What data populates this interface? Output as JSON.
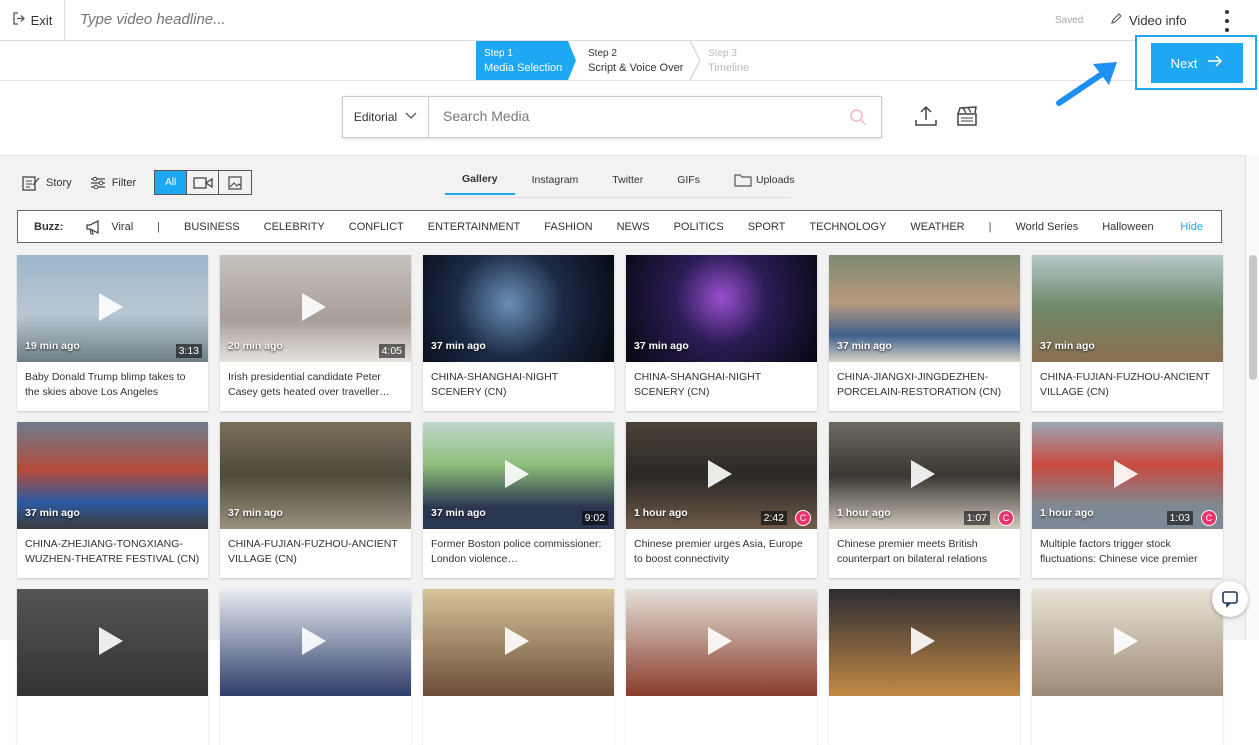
{
  "topbar": {
    "exit_label": "Exit",
    "headline_placeholder": "Type video headline...",
    "saved_label": "Saved",
    "video_info_label": "Video info"
  },
  "steps": [
    {
      "number": "Step 1",
      "label": "Media Selection",
      "state": "active"
    },
    {
      "number": "Step 2",
      "label": "Script & Voice Over",
      "state": "enabled"
    },
    {
      "number": "Step 3",
      "label": "Timeline",
      "state": "disabled"
    }
  ],
  "next_button_label": "Next",
  "accent_color": "#1ea7f3",
  "search": {
    "source_selected": "Editorial",
    "placeholder": "Search Media"
  },
  "toolbar": {
    "story_label": "Story",
    "filter_label": "Filter",
    "type_all_label": "All"
  },
  "source_tabs": [
    "Gallery",
    "Instagram",
    "Twitter",
    "GIFs",
    "Uploads"
  ],
  "buzz": {
    "label": "Buzz:",
    "viral_label": "Viral",
    "categories": [
      "BUSINESS",
      "CELEBRITY",
      "CONFLICT",
      "ENTERTAINMENT",
      "FASHION",
      "NEWS",
      "POLITICS",
      "SPORT",
      "TECHNOLOGY",
      "WEATHER"
    ],
    "trending": [
      "World Series",
      "Halloween"
    ],
    "hide_label": "Hide"
  },
  "media": [
    {
      "age": "19 min ago",
      "duration": "3:13",
      "title": "Baby Donald Trump blimp takes to the skies above Los Angeles",
      "badge": false,
      "play": true
    },
    {
      "age": "20 min ago",
      "duration": "4:05",
      "title": "Irish presidential candidate Peter Casey gets heated over traveller…",
      "badge": false,
      "play": true
    },
    {
      "age": "37 min ago",
      "duration": "",
      "title": "CHINA-SHANGHAI-NIGHT SCENERY (CN)",
      "badge": false,
      "play": false
    },
    {
      "age": "37 min ago",
      "duration": "",
      "title": "CHINA-SHANGHAI-NIGHT SCENERY (CN)",
      "badge": false,
      "play": false
    },
    {
      "age": "37 min ago",
      "duration": "",
      "title": "CHINA-JIANGXI-JINGDEZHEN-PORCELAIN-RESTORATION (CN)",
      "badge": false,
      "play": false
    },
    {
      "age": "37 min ago",
      "duration": "",
      "title": "CHINA-FUJIAN-FUZHOU-ANCIENT VILLAGE (CN)",
      "badge": false,
      "play": false
    },
    {
      "age": "37 min ago",
      "duration": "",
      "title": "CHINA-ZHEJIANG-TONGXIANG-WUZHEN-THEATRE FESTIVAL (CN)",
      "badge": false,
      "play": false
    },
    {
      "age": "37 min ago",
      "duration": "",
      "title": "CHINA-FUJIAN-FUZHOU-ANCIENT VILLAGE (CN)",
      "badge": false,
      "play": false
    },
    {
      "age": "37 min ago",
      "duration": "9:02",
      "title": "Former Boston police commissioner: London violence…",
      "badge": false,
      "play": true
    },
    {
      "age": "1 hour ago",
      "duration": "2:42",
      "title": "Chinese premier urges Asia, Europe to boost connectivity",
      "badge": true,
      "play": true
    },
    {
      "age": "1 hour ago",
      "duration": "1:07",
      "title": "Chinese premier meets British counterpart on bilateral relations",
      "badge": true,
      "play": true
    },
    {
      "age": "1 hour ago",
      "duration": "1:03",
      "title": "Multiple factors trigger stock fluctuations: Chinese vice premier",
      "badge": true,
      "play": true
    },
    {
      "age": "",
      "duration": "",
      "title": "",
      "badge": false,
      "play": true
    },
    {
      "age": "",
      "duration": "",
      "title": "",
      "badge": false,
      "play": true
    },
    {
      "age": "",
      "duration": "",
      "title": "",
      "badge": false,
      "play": true
    },
    {
      "age": "",
      "duration": "",
      "title": "",
      "badge": false,
      "play": true
    },
    {
      "age": "",
      "duration": "",
      "title": "",
      "badge": false,
      "play": true
    },
    {
      "age": "",
      "duration": "",
      "title": "",
      "badge": false,
      "play": true
    }
  ],
  "badge_letter": "C",
  "icons": [
    "exit-icon",
    "pencil-icon",
    "more-vertical-icon",
    "arrow-right-icon",
    "chevron-down-icon",
    "search-icon",
    "upload-icon",
    "clapperboard-icon",
    "story-icon",
    "filter-icon",
    "video-icon",
    "image-icon",
    "folder-icon",
    "megaphone-icon",
    "play-icon",
    "chat-icon"
  ]
}
